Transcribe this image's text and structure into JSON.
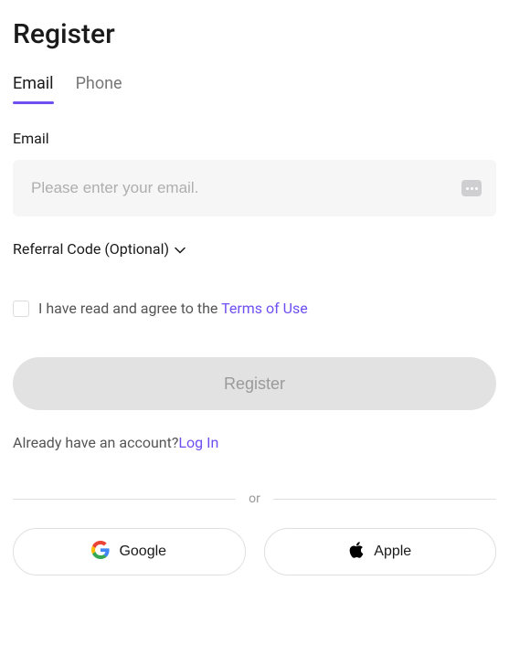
{
  "title": "Register",
  "tabs": {
    "email": "Email",
    "phone": "Phone"
  },
  "form": {
    "emailLabel": "Email",
    "emailPlaceholder": "Please enter your email.",
    "referralLabel": "Referral Code (Optional)",
    "termsPrefix": "I have read and agree to the ",
    "termsLink": "Terms of Use",
    "registerButton": "Register"
  },
  "login": {
    "prompt": "Already have an account?",
    "link": "Log In"
  },
  "divider": "or",
  "social": {
    "google": "Google",
    "apple": "Apple"
  }
}
